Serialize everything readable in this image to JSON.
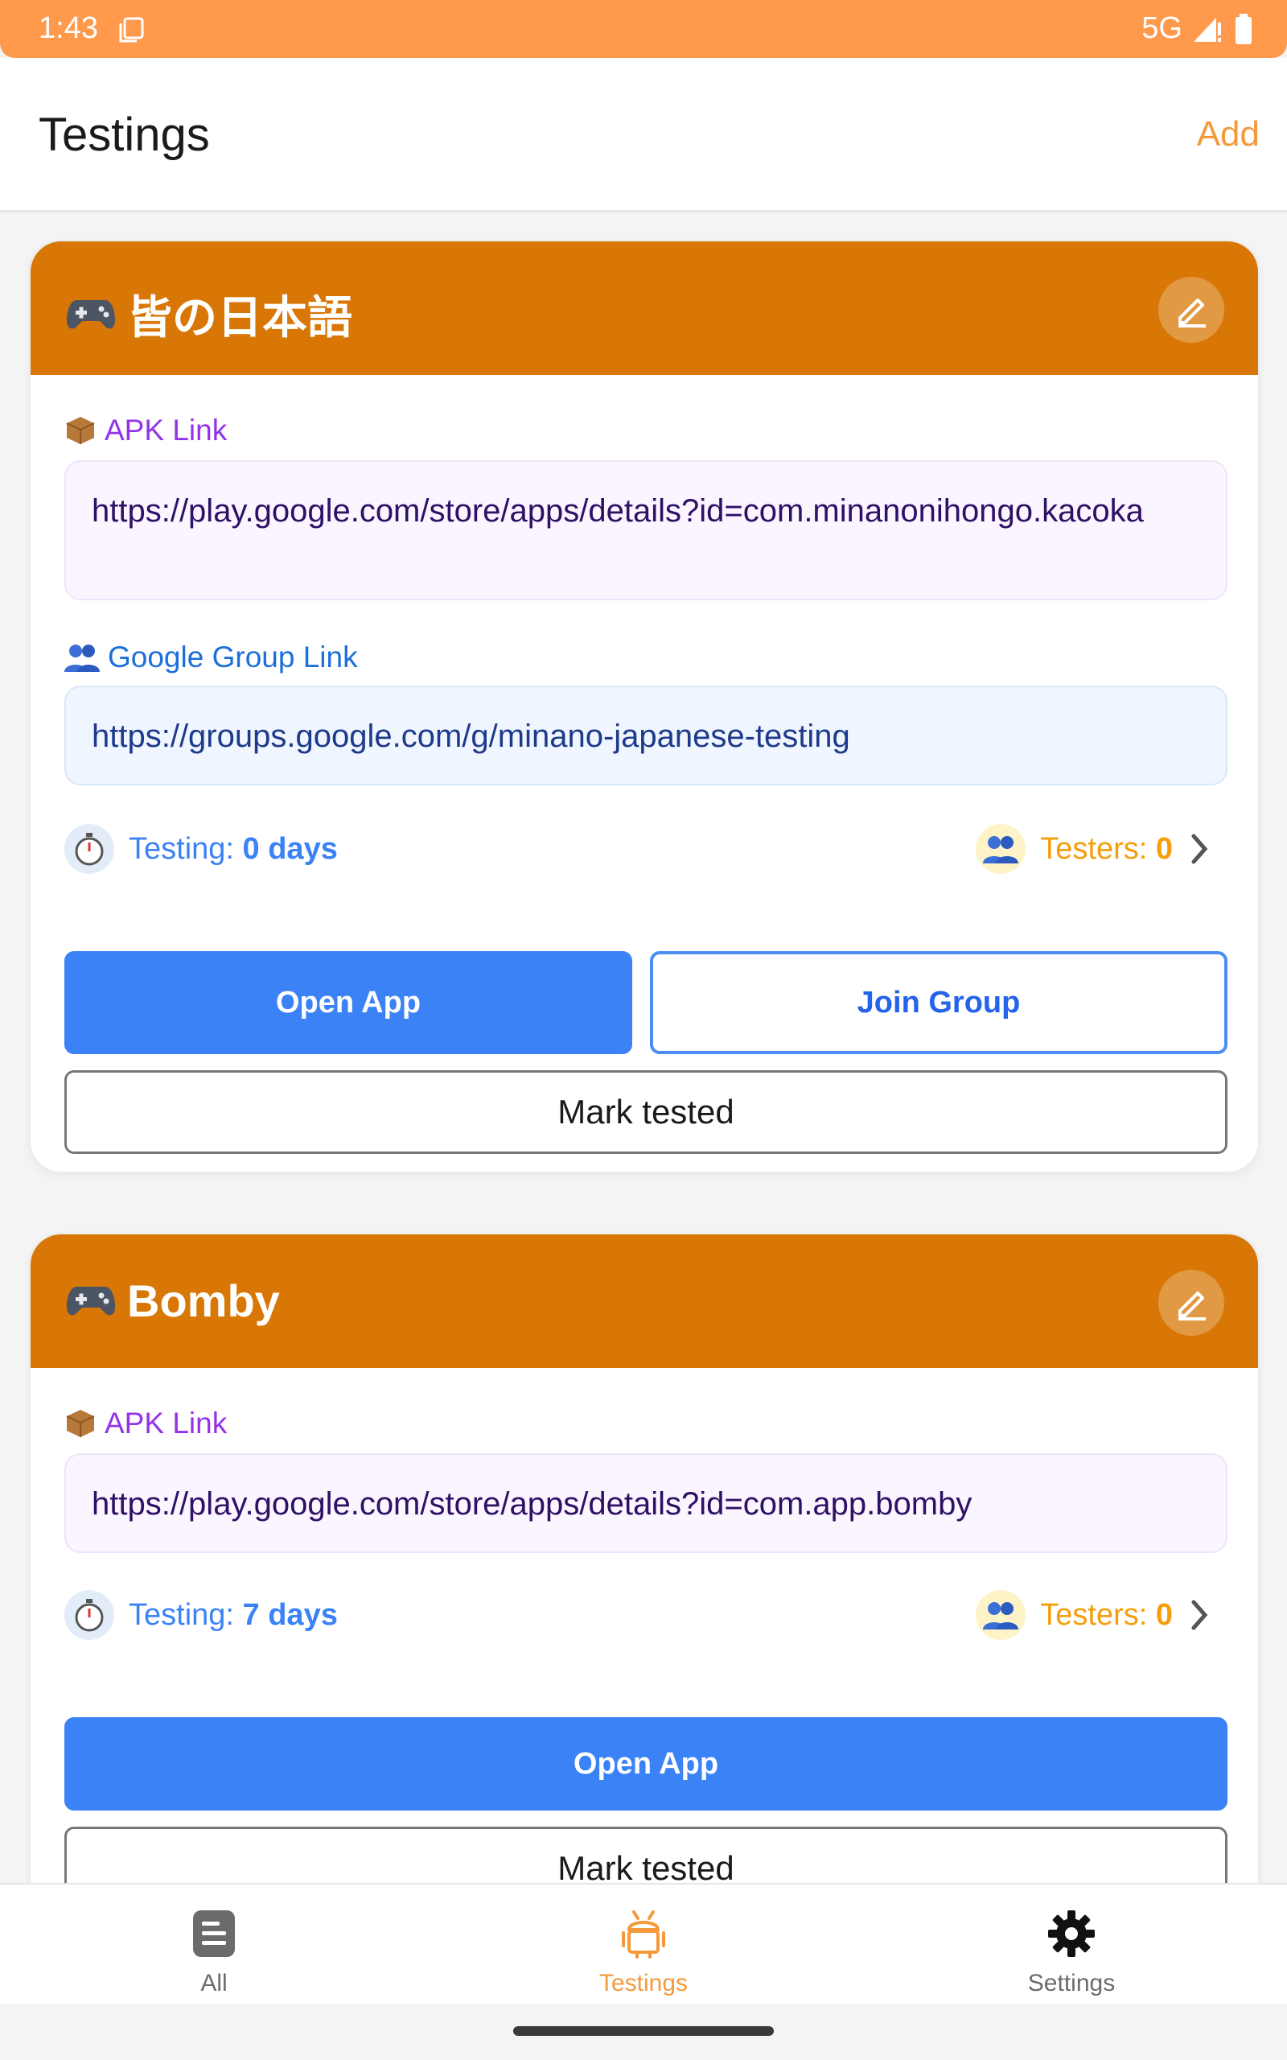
{
  "status_bar": {
    "time": "1:43",
    "network": "5G"
  },
  "header": {
    "title": "Testings",
    "add_label": "Add"
  },
  "apps": [
    {
      "name": "皆の日本語",
      "apk_label": "APK Link",
      "apk_link": "https://play.google.com/store/apps/details?id=com.minanonihongo.kacoka",
      "group_label": "Google Group Link",
      "group_link": "https://groups.google.com/g/minano-japanese-testing",
      "testing_label": "Testing:",
      "testing_days": "0 days",
      "testers_label": "Testers:",
      "testers_count": "0",
      "open_app_label": "Open App",
      "join_group_label": "Join Group",
      "mark_tested_label": "Mark tested"
    },
    {
      "name": "Bomby",
      "apk_label": "APK Link",
      "apk_link": "https://play.google.com/store/apps/details?id=com.app.bomby",
      "testing_label": "Testing:",
      "testing_days": "7 days",
      "testers_label": "Testers:",
      "testers_count": "0",
      "open_app_label": "Open App",
      "mark_tested_label": "Mark tested"
    }
  ],
  "bottom_nav": {
    "items": [
      {
        "label": "All",
        "icon": "document-icon"
      },
      {
        "label": "Testings",
        "icon": "android-icon",
        "active": true
      },
      {
        "label": "Settings",
        "icon": "gear-icon"
      }
    ]
  },
  "colors": {
    "status_bar": "#ff9a4d",
    "card_header": "#d97706",
    "primary_button": "#3b82f6",
    "accent_orange": "#f59a3c"
  }
}
